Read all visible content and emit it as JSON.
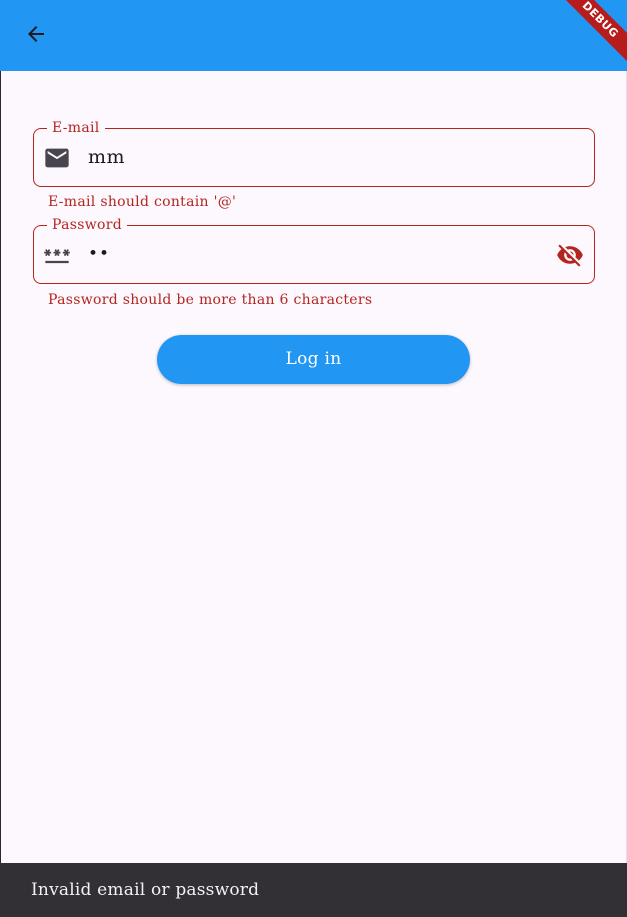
{
  "app_bar": {
    "back_icon": "arrow-back-icon",
    "debug_banner": "DEBUG",
    "color": "#2196F3"
  },
  "email_field": {
    "label": "E-mail",
    "icon": "mail-icon",
    "value": "mm",
    "error": "E-mail should contain '@'"
  },
  "password_field": {
    "label": "Password",
    "icon": "password-icon",
    "value": "••",
    "toggle_icon": "visibility-off-icon",
    "error": "Password should be more than 6 characters"
  },
  "login_button": {
    "label": "Log in"
  },
  "snackbar": {
    "message": "Invalid email or password"
  },
  "colors": {
    "primary": "#2196F3",
    "error": "#B3261E",
    "background": "#FDF7FE",
    "snackbar": "#322F35"
  }
}
